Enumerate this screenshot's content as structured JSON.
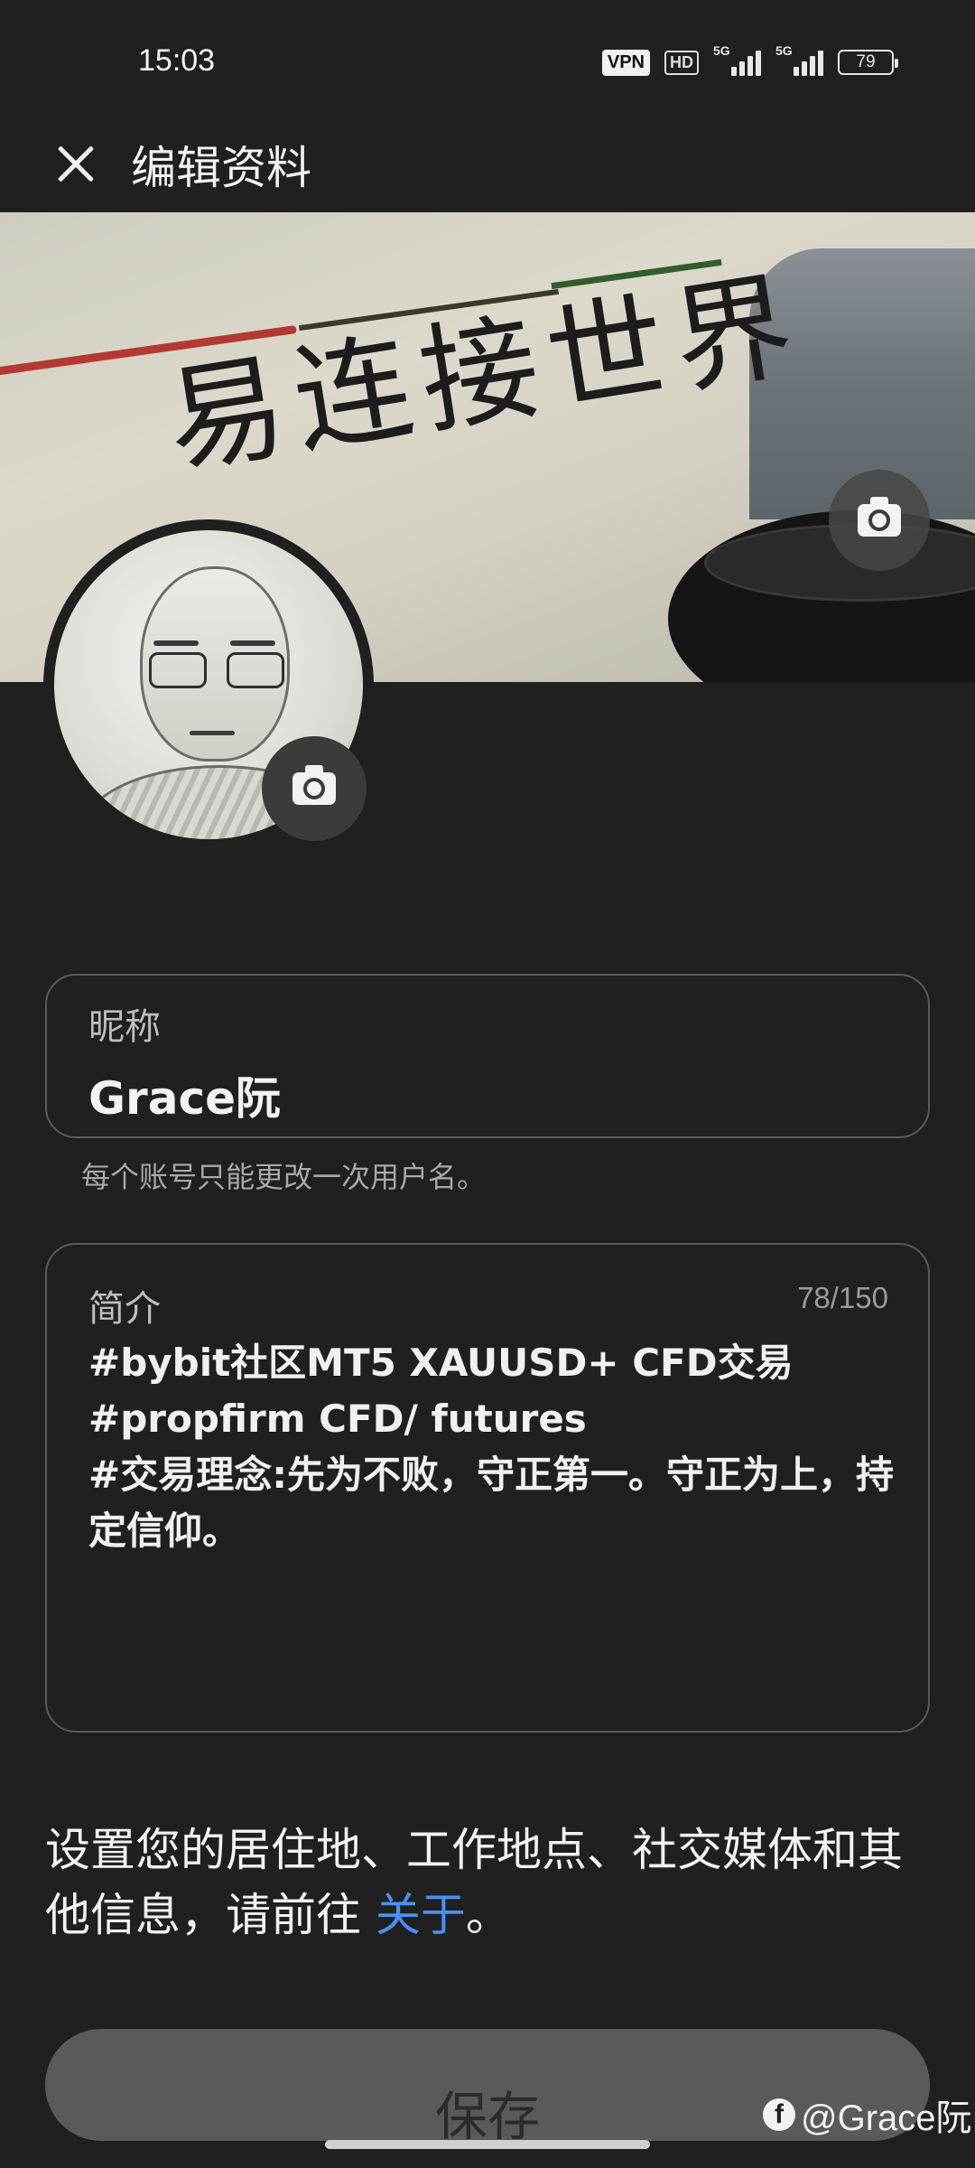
{
  "status_bar": {
    "time": "15:03",
    "vpn": "VPN",
    "hd": "HD",
    "signal1_label": "5G",
    "signal2_label": "5G",
    "battery": "79"
  },
  "header": {
    "title": "编辑资料",
    "close_icon": "close-icon"
  },
  "cover": {
    "calligraphy": "易连接世界",
    "camera_icon": "camera-icon"
  },
  "avatar": {
    "camera_icon": "camera-icon"
  },
  "nickname": {
    "label": "昵称",
    "value": "Grace阮",
    "helper": "每个账号只能更改一次用户名。"
  },
  "bio": {
    "label": "简介",
    "counter": "78/150",
    "text": "#bybit社区MT5 XAUUSD+ CFD交易\n#propfirm CFD/ futures\n#交易理念:先为不败，守正第一。守正为上，持定信仰。"
  },
  "info": {
    "prefix": "设置您的居住地、工作地点、社交媒体和其他信息，请前往 ",
    "link": "关于",
    "suffix": "。",
    "link_color": "#4a8ff5"
  },
  "save_label": "保存",
  "watermark": {
    "icon": "facebook-icon",
    "text": "@Grace阮"
  }
}
